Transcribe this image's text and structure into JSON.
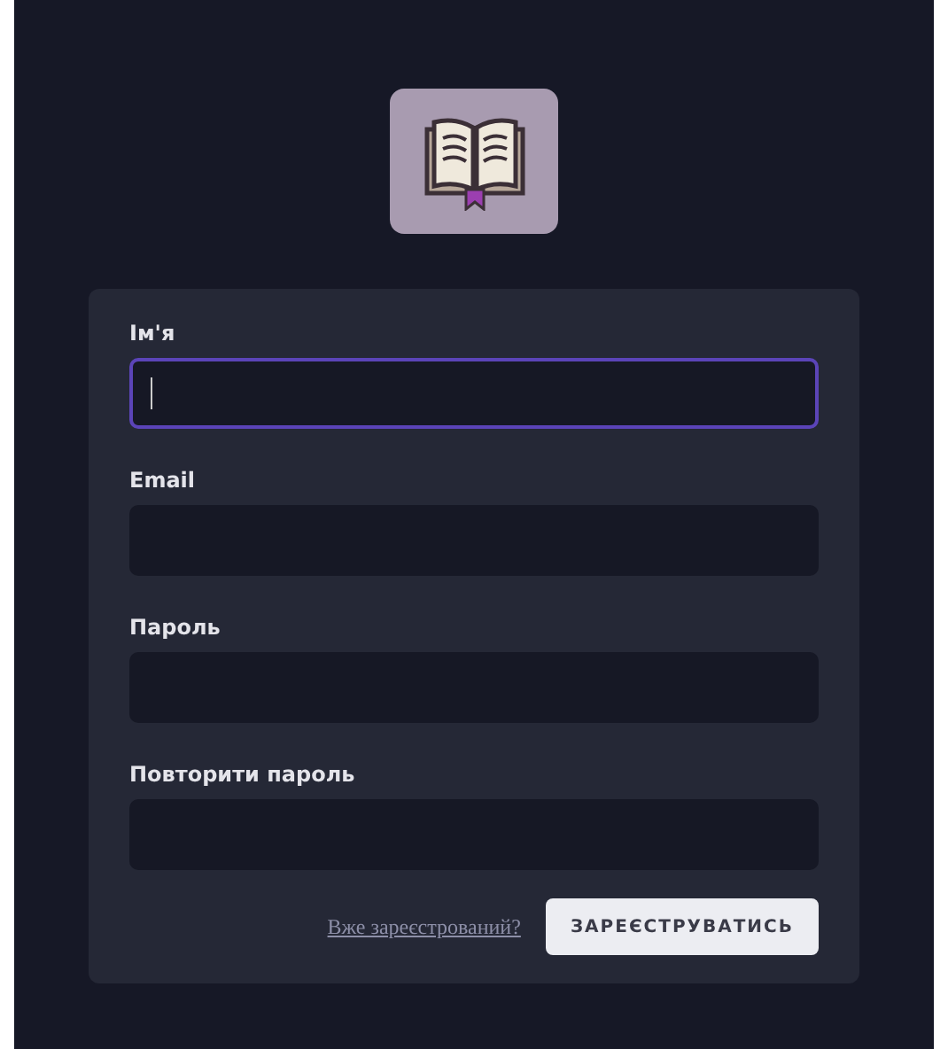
{
  "fields": [
    {
      "label": "Ім'я",
      "focused": true
    },
    {
      "label": "Email",
      "focused": false
    },
    {
      "label": "Пароль",
      "focused": false
    },
    {
      "label": "Повторити пароль",
      "focused": false
    }
  ],
  "login_link": "Вже зареєстрований?",
  "submit_button": "ЗАРЕЄСТРУВАТИСЬ"
}
